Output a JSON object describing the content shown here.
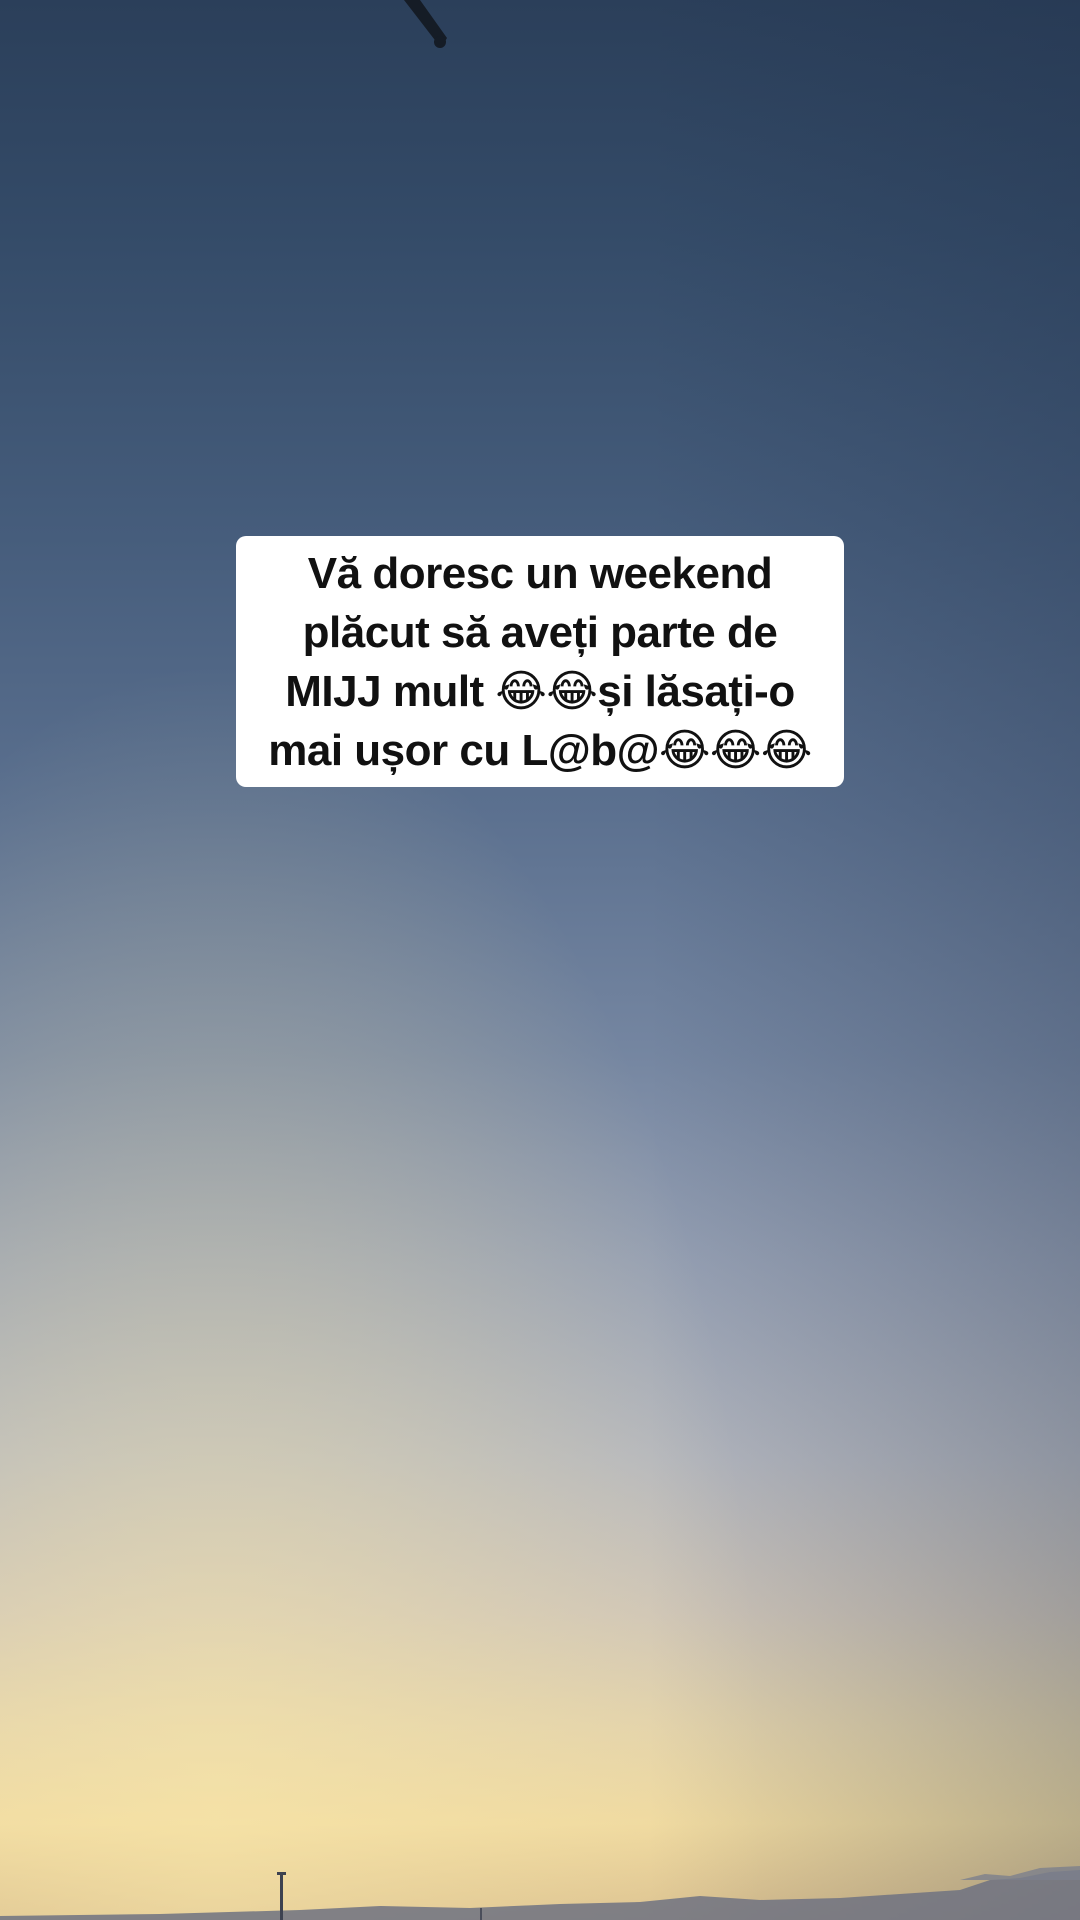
{
  "background": {
    "type": "sunset-sky-photo",
    "colors": {
      "top": "#2b3f5a",
      "middle": "#7586a1",
      "bottom_glow": "#efd9a0"
    }
  },
  "caption": {
    "text": "Vă doresc un weekend\nplăcut să aveți parte de\nMIJJ mult 😂😂și lăsați-o\nmai ușor cu L@b@😂😂😂",
    "background_color": "#ffffff",
    "text_color": "#111111"
  }
}
